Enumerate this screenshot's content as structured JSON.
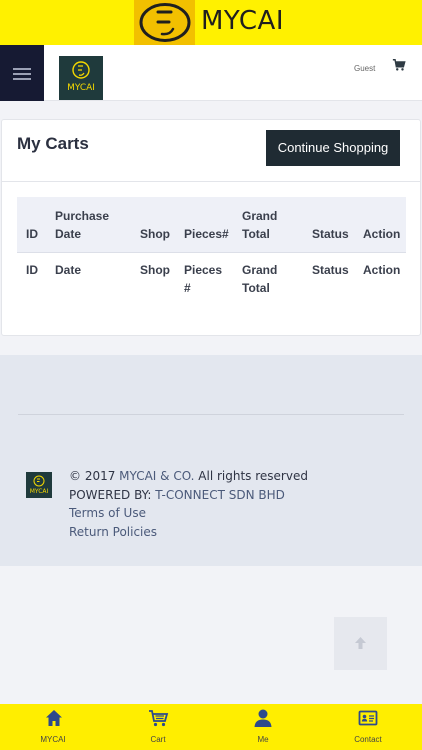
{
  "brand": {
    "title": "MYCAI",
    "logo_icon": "smiley-logo-icon",
    "accent": "#fff100"
  },
  "nav": {
    "menu_icon": "hamburger-icon",
    "logo_text": "MYCAI",
    "user_label": "Guest",
    "cart_icon": "cart-icon"
  },
  "card": {
    "title": "My Carts",
    "continue_label": "Continue Shopping",
    "headers": [
      "ID",
      "Purchase Date",
      "Shop",
      "Pieces#",
      "Grand Total",
      "Status",
      "Action"
    ],
    "row": [
      "ID",
      "Date",
      "Shop",
      "Pieces #",
      "Grand Total",
      "Status",
      "Action"
    ]
  },
  "footer": {
    "copyright_prefix": "© 2017 ",
    "company": "MYCAI & CO.",
    "copyright_suffix": " All rights reserved",
    "powered_prefix": "POWERED BY: ",
    "powered_by": "T-CONNECT SDN BHD",
    "terms": "Terms of Use",
    "returns": "Return Policies",
    "logo_text": "MYCAI"
  },
  "back_to_top_icon": "arrow-up-icon",
  "tabs": [
    {
      "label": "MYCAI",
      "icon": "home-icon"
    },
    {
      "label": "Cart",
      "icon": "cart-icon"
    },
    {
      "label": "Me",
      "icon": "user-icon"
    },
    {
      "label": "Contact",
      "icon": "contact-card-icon"
    }
  ]
}
